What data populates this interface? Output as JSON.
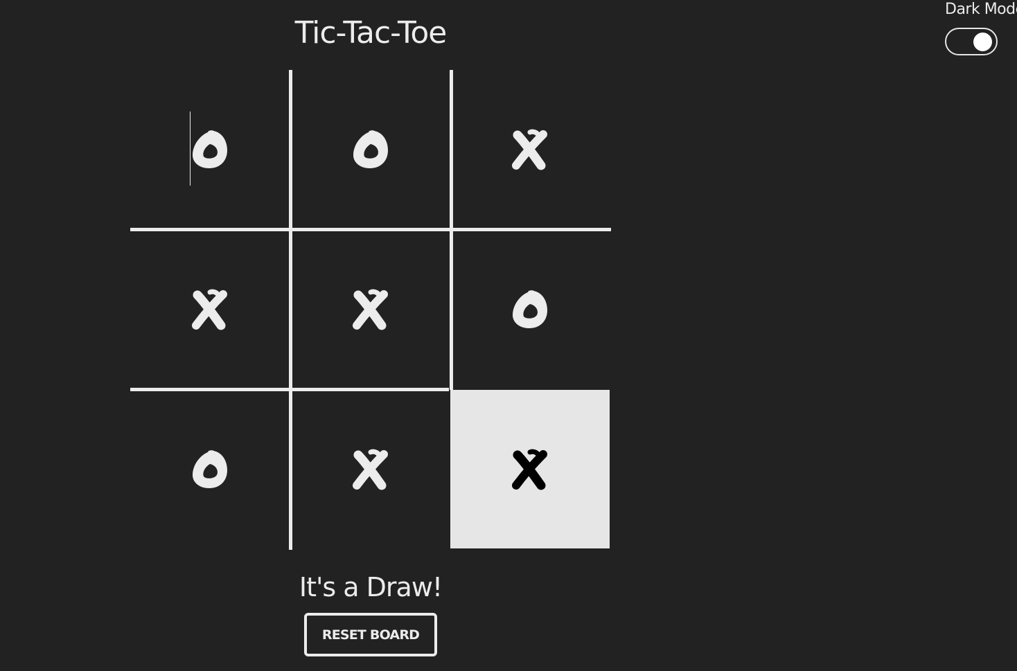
{
  "title": "Tic-Tac-Toe",
  "dark_mode": {
    "label": "Dark Mode",
    "enabled": true
  },
  "board": {
    "cells": [
      "O",
      "O",
      "X",
      "X",
      "X",
      "O",
      "O",
      "X",
      "X"
    ],
    "highlighted_cells": [
      8
    ]
  },
  "status": "It's a Draw!",
  "reset_button": {
    "label": "RESET BOARD"
  },
  "colors": {
    "background": "#222222",
    "foreground": "#ececec",
    "highlight": "#e6e6e6",
    "highlight_mark": "#000000"
  }
}
